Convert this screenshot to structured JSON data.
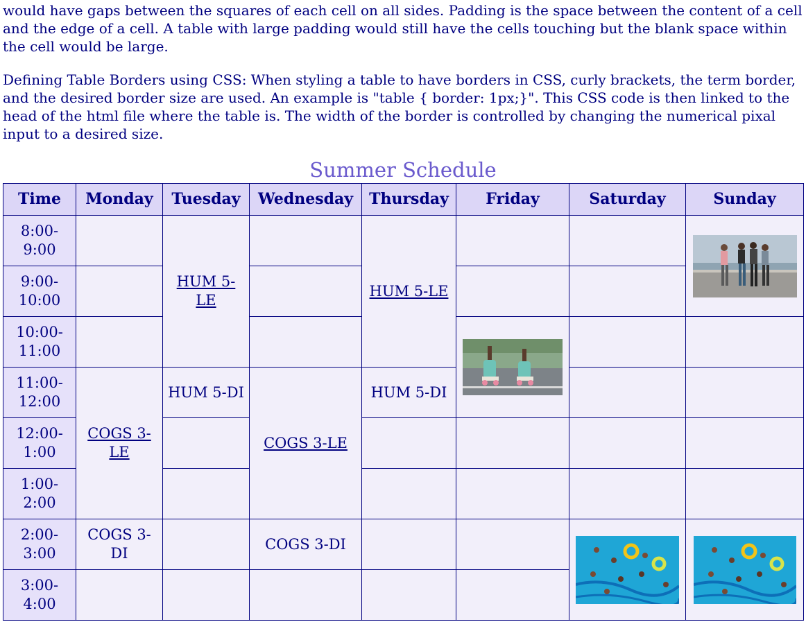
{
  "paragraphs": {
    "p1": "would have gaps between the squares of each cell on all sides. Padding is the space between the content of a cell and the edge of a cell. A table with large padding would still have the cells touching but the blank space within the cell would be large.",
    "p2": "Defining Table Borders using CSS: When styling a table to have borders in CSS, curly brackets, the term border, and the desired border size are used. An example is \"table { border: 1px;}\". This CSS code is then linked to the head of the html file where the table is. The width of the border is controlled by changing the numerical pixal input to a desired size."
  },
  "schedule": {
    "caption": "Summer Schedule",
    "headers": [
      "Time",
      "Monday",
      "Tuesday",
      "Wednesday",
      "Thursday",
      "Friday",
      "Saturday",
      "Sunday"
    ],
    "times": [
      "8:00-9:00",
      "9:00-10:00",
      "10:00-11:00",
      "11:00-12:00",
      "12:00-1:00",
      "1:00-2:00",
      "2:00-3:00",
      "3:00-4:00"
    ],
    "courses": {
      "tue_hum_le": "HUM 5-LE",
      "thu_hum_le": "HUM 5-LE",
      "tue_hum_di": "HUM 5-DI",
      "thu_hum_di": "HUM 5-DI",
      "mon_cogs_le": "COGS 3-LE",
      "wed_cogs_le": "COGS 3-LE",
      "mon_cogs_di": "COGS 3-DI",
      "wed_cogs_di": "COGS 3-DI"
    },
    "images": {
      "sunday_top": "people-walking-photo",
      "friday": "roller-skates-photo",
      "saturday_pool": "swimming-pool-photo",
      "sunday_pool": "swimming-pool-photo"
    }
  }
}
